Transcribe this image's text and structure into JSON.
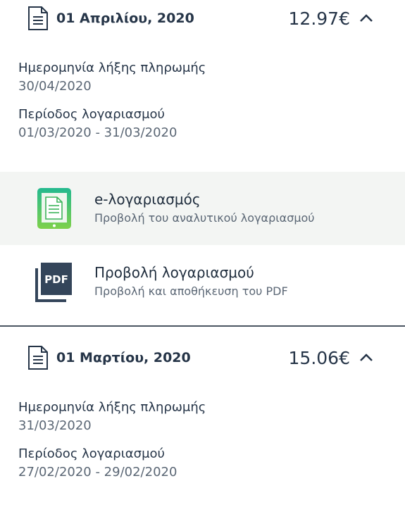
{
  "bills": [
    {
      "date": "01 Απριλίου, 2020",
      "amount": "12.97€",
      "due_label": "Ημερομηνία λήξης πληρωμής",
      "due_value": "30/04/2020",
      "period_label": "Περίοδος λογαριασμού",
      "period_value": "01/03/2020 - 31/03/2020",
      "actions": [
        {
          "icon": "tablet-document-icon",
          "title": "e-λογαριασμός",
          "subtitle": "Προβολή του αναλυτικού λογαριασμού"
        },
        {
          "icon": "pdf-icon",
          "title": "Προβολή λογαριασμού",
          "subtitle": "Προβολή και αποθήκευση του PDF",
          "icon_text": "PDF"
        }
      ]
    },
    {
      "date": "01 Μαρτίου, 2020",
      "amount": "15.06€",
      "due_label": "Ημερομηνία λήξης πληρωμής",
      "due_value": "31/03/2020",
      "period_label": "Περίοδος λογαριασμού",
      "period_value": "27/02/2020 - 29/02/2020"
    }
  ],
  "colors": {
    "text_dark": "#263548",
    "text_muted": "#5b6775",
    "shaded_bg": "#f3f5f3",
    "divider": "#4a5562",
    "tablet_green": "#3cc46a",
    "pdf_navy": "#34455a"
  }
}
